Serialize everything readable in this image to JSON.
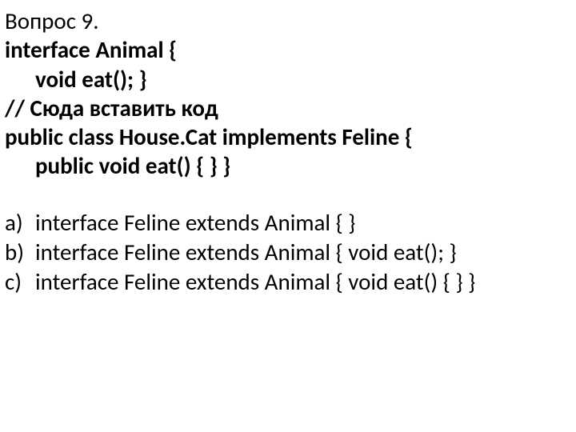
{
  "question": {
    "title": "Вопрос 9.",
    "code": {
      "l1": "interface Animal {",
      "l2": "void eat(); }",
      "l3": "// Сюда вставить код",
      "l4": "public class House.Cat implements Feline {",
      "l5": "public void eat() { } }"
    }
  },
  "answers": [
    {
      "label": "a)",
      "text": "interface Feline extends Animal { }"
    },
    {
      "label": "b)",
      "text": "interface Feline extends Animal { void eat(); }"
    },
    {
      "label": "c)",
      "text": "interface Feline extends Animal { void eat() { } }"
    }
  ]
}
